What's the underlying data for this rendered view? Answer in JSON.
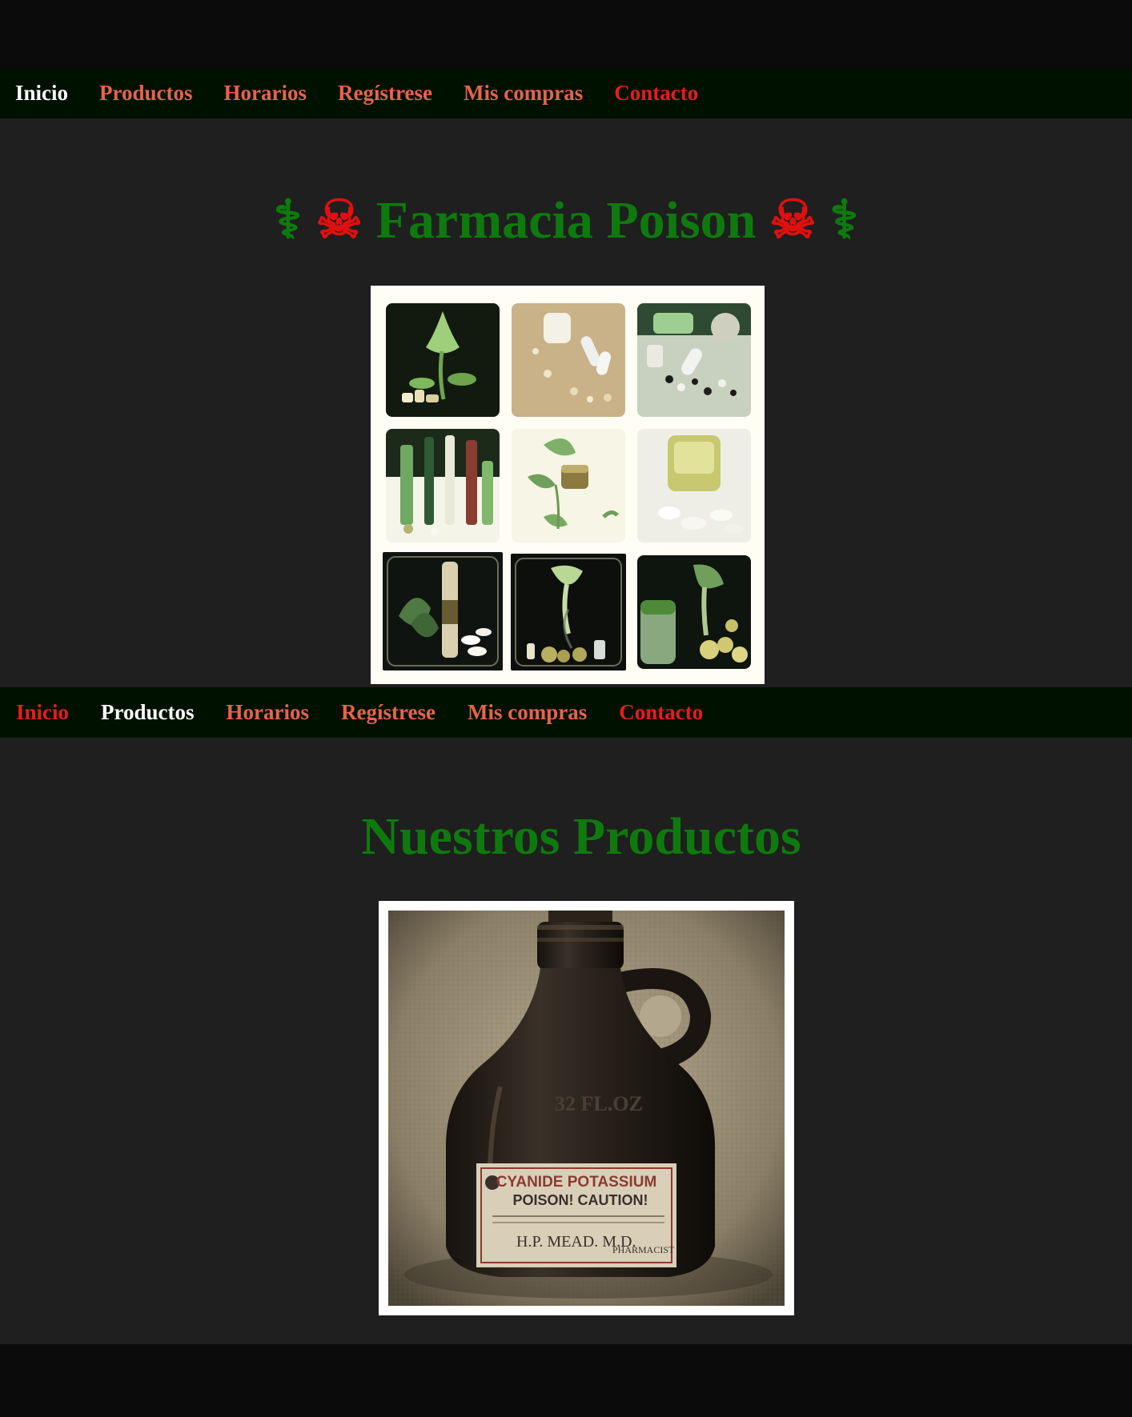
{
  "nav_top": {
    "items": [
      {
        "label": "Inicio",
        "color": "#ffffff"
      },
      {
        "label": "Productos",
        "color": "#e8634a"
      },
      {
        "label": "Horarios",
        "color": "#e8634a"
      },
      {
        "label": "Regístrese",
        "color": "#e8634a"
      },
      {
        "label": "Mis compras",
        "color": "#e8634a"
      },
      {
        "label": "Contacto",
        "color": "#e81c1c"
      }
    ]
  },
  "hero": {
    "caduceus": "⚕",
    "skull": "☠",
    "title": "Farmacia Poison"
  },
  "nav_products": {
    "items": [
      {
        "label": "Inicio",
        "color": "#e81c1c"
      },
      {
        "label": "Productos",
        "color": "#ffffff"
      },
      {
        "label": "Horarios",
        "color": "#e8634a"
      },
      {
        "label": "Regístrese",
        "color": "#e8634a"
      },
      {
        "label": "Mis compras",
        "color": "#e8634a"
      },
      {
        "label": "Contacto",
        "color": "#e81c1c"
      }
    ]
  },
  "products": {
    "title": "Nuestros Productos",
    "bottle_label": {
      "line1": "CYANIDE POTASSIUM",
      "line2": "POISON! CAUTION!",
      "line3": "H.P. MEAD. M.D.",
      "line4": "PHARMACIST",
      "embossed": "32 FL.OZ"
    }
  },
  "colors": {
    "accent_green": "#0e7a0e",
    "nav_bg": "#001100",
    "section_bg": "#1f1f1f",
    "page_bg": "#0b0b0b"
  }
}
